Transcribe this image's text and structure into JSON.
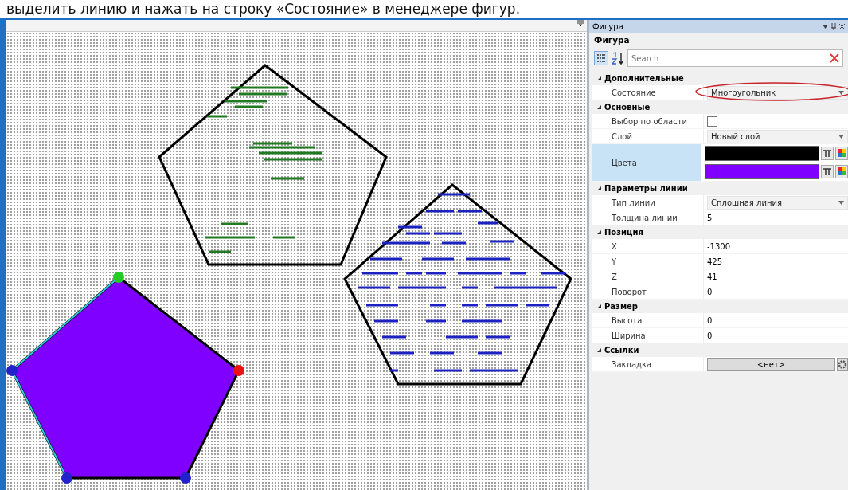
{
  "caption": "выделить линию и нажать на строку «Состояние» в менеджере фигур.",
  "panel": {
    "title": "Фигура",
    "header": "Фигура",
    "search": {
      "placeholder": "Search"
    },
    "categories": [
      {
        "name": "Дополнительные",
        "expanded": true,
        "rows": [
          {
            "label": "Состояние",
            "kind": "dropdown",
            "value": "Многоугольник",
            "annotated": true
          }
        ]
      },
      {
        "name": "Основные",
        "expanded": true,
        "rows": [
          {
            "label": "Выбор по области",
            "kind": "checkbox",
            "checked": false
          },
          {
            "label": "Слой",
            "kind": "dropdown",
            "value": "Новый слой"
          },
          {
            "label": "Цвета",
            "kind": "colors",
            "selected": true,
            "swatches": [
              {
                "color": "#000000"
              },
              {
                "color": "#8000ff"
              }
            ]
          }
        ]
      },
      {
        "name": "Параметры линии",
        "expanded": true,
        "rows": [
          {
            "label": "Тип линии",
            "kind": "dropdown",
            "value": "Сплошная линия"
          },
          {
            "label": "Толщина линии",
            "kind": "text",
            "value": "5"
          }
        ]
      },
      {
        "name": "Позиция",
        "expanded": true,
        "rows": [
          {
            "label": "X",
            "kind": "text",
            "value": "-1300"
          },
          {
            "label": "Y",
            "kind": "text",
            "value": "425"
          },
          {
            "label": "Z",
            "kind": "text",
            "value": "41"
          },
          {
            "label": "Поворот",
            "kind": "text",
            "value": "0"
          }
        ]
      },
      {
        "name": "Размер",
        "expanded": true,
        "rows": [
          {
            "label": "Высота",
            "kind": "text",
            "value": "0"
          },
          {
            "label": "Ширина",
            "kind": "text",
            "value": "0"
          }
        ]
      },
      {
        "name": "Ссылки",
        "expanded": true,
        "rows": [
          {
            "label": "Закладка",
            "kind": "button",
            "value": "<нет>"
          }
        ]
      }
    ]
  }
}
